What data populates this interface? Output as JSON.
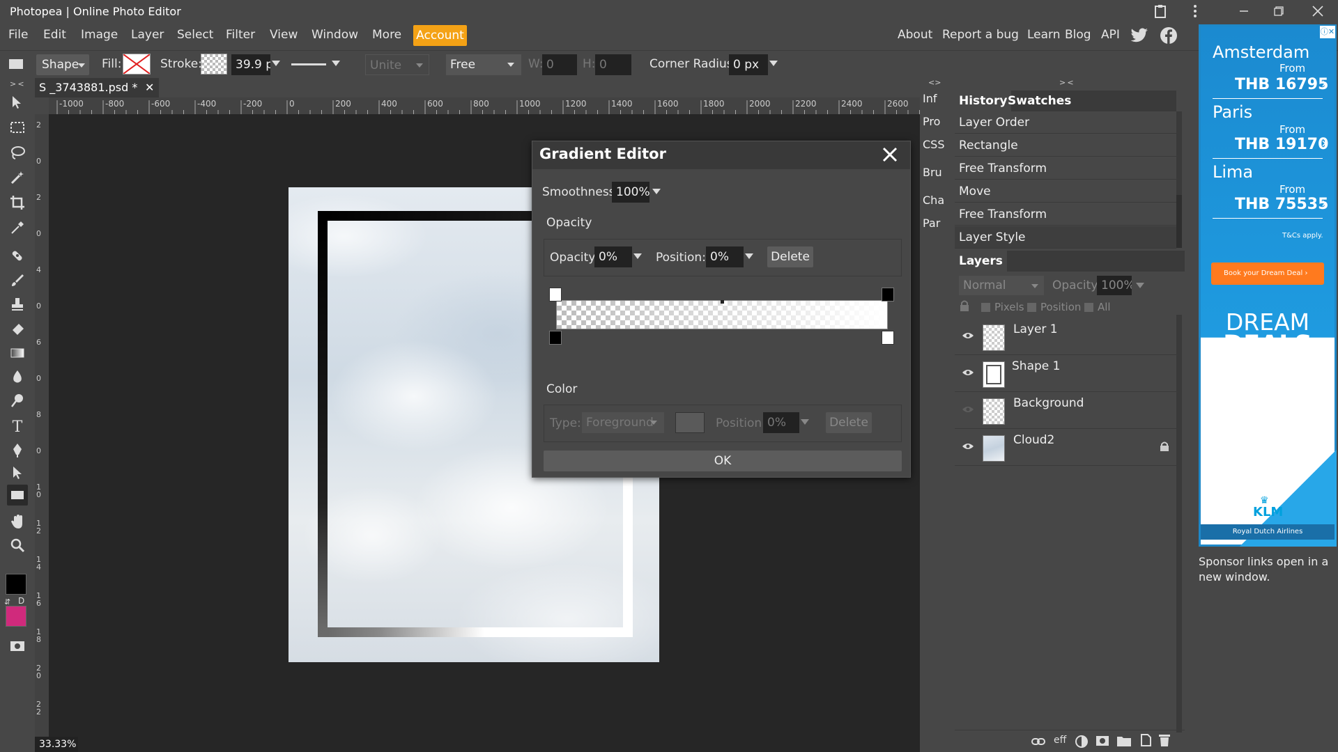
{
  "window": {
    "title": "Photopea | Online Photo Editor"
  },
  "menu": {
    "items": [
      "File",
      "Edit",
      "Image",
      "Layer",
      "Select",
      "Filter",
      "View",
      "Window",
      "More"
    ],
    "account": "Account",
    "right_links": [
      "About",
      "Report a bug",
      "Learn",
      "Blog",
      "API"
    ]
  },
  "options": {
    "shape_mode": "Shape",
    "fill_label": "Fill:",
    "stroke_label": "Stroke:",
    "stroke_width": "39.9 p",
    "combine": "Unite",
    "aspect": "Free",
    "w_label": "W:",
    "w_value": "0",
    "h_label": "H:",
    "h_value": "0",
    "corner_label": "Corner Radius:",
    "corner_value": "0 px"
  },
  "panel_toggles": {
    "left": "> <",
    "mid": "<>",
    "right": "> <"
  },
  "document": {
    "tab": "S _3743881.psd *",
    "zoom": "33.33%"
  },
  "rulers": {
    "top": [
      "-1000",
      "-800",
      "-600",
      "-400",
      "-200",
      "0",
      "200",
      "400",
      "600",
      "800",
      "1000",
      "1200",
      "1400",
      "1600",
      "1800",
      "2000",
      "2200",
      "2400",
      "2600"
    ],
    "left": [
      "2",
      "0",
      "2",
      "0",
      "4",
      "0",
      "6",
      "0",
      "8",
      "0",
      "1 0",
      "1 2",
      "1 4",
      "1 6",
      "1 8",
      "2 0",
      "2 2"
    ]
  },
  "gradient_editor": {
    "title": "Gradient Editor",
    "smoothness_label": "Smoothness:",
    "smoothness": "100%",
    "opacity_section": "Opacity",
    "opacity_label": "Opacity:",
    "opacity_value": "0%",
    "position_label": "Position:",
    "position_value": "0%",
    "delete": "Delete",
    "color_section": "Color",
    "type_label": "Type:",
    "type_value": "Foreground",
    "color_position_label": "Position:",
    "color_position_value": "0%",
    "color_delete": "Delete",
    "ok": "OK"
  },
  "mini_panel": [
    "Inf",
    "Pro",
    "CSS",
    "Bru",
    "Cha",
    "Par"
  ],
  "history": {
    "tabs": [
      "History",
      "Swatches"
    ],
    "items": [
      "Layer Order",
      "Rectangle",
      "Free Transform",
      "Move",
      "Free Transform",
      "Layer Style"
    ]
  },
  "layers": {
    "tab": "Layers",
    "blend": "Normal",
    "opacity_label": "Opacity:",
    "opacity": "100%",
    "lock_options": [
      "Pixels",
      "Position",
      "All"
    ],
    "items": [
      {
        "name": "Layer 1",
        "visible": true,
        "locked": false
      },
      {
        "name": "Shape 1",
        "visible": true,
        "locked": false
      },
      {
        "name": "Background",
        "visible": false,
        "locked": false
      },
      {
        "name": "Cloud2",
        "visible": true,
        "locked": true
      }
    ],
    "footer_icons": [
      "link-icon",
      "eff",
      "adjustment-icon",
      "mask-icon",
      "folder-icon",
      "new-layer-icon",
      "trash-icon"
    ]
  },
  "ad": {
    "deals": [
      {
        "city": "Amsterdam",
        "from": "From",
        "price": "THB 16795"
      },
      {
        "city": "Paris",
        "from": "From",
        "price": "THB 19170"
      },
      {
        "city": "Lima",
        "from": "From",
        "price": "THB 75535"
      }
    ],
    "tc": "T&Cs apply.",
    "cta": "Book your Dream Deal",
    "headline1": "DREAM",
    "headline2": "DEALS",
    "brand": "KLM",
    "airline": "Royal Dutch Airlines",
    "sponsor_note": "Sponsor links open in a new window."
  },
  "colors": {
    "accent": "#f4a216",
    "foreground": "#000000",
    "background": "#d02a7c",
    "panel": "#474747",
    "canvas_bg": "#262626"
  }
}
